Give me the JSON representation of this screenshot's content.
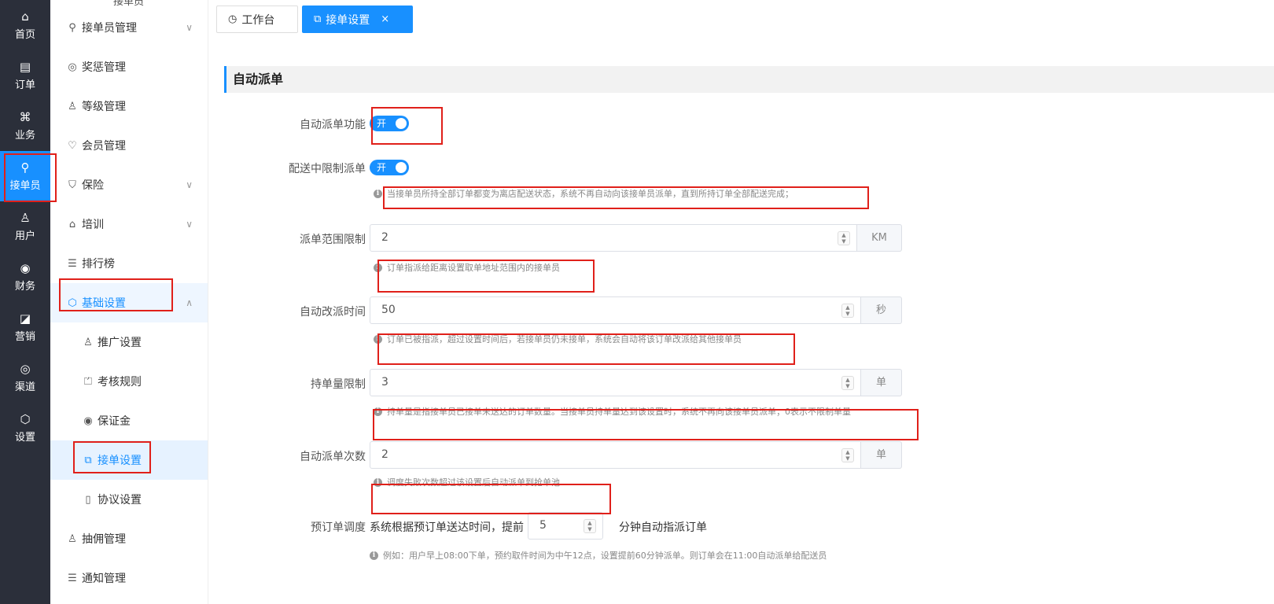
{
  "rail": {
    "items": [
      {
        "label": "首页",
        "icon": "home-icon"
      },
      {
        "label": "订单",
        "icon": "order-icon"
      },
      {
        "label": "业务",
        "icon": "business-icon"
      },
      {
        "label": "接单员",
        "icon": "rider-icon"
      },
      {
        "label": "用户",
        "icon": "user-icon"
      },
      {
        "label": "财务",
        "icon": "finance-icon"
      },
      {
        "label": "营销",
        "icon": "marketing-icon"
      },
      {
        "label": "渠道",
        "icon": "channel-icon"
      },
      {
        "label": "设置",
        "icon": "settings-icon"
      }
    ]
  },
  "sidebar": {
    "top_label": "接单员",
    "items": [
      {
        "label": "接单员管理"
      },
      {
        "label": "奖惩管理"
      },
      {
        "label": "等级管理"
      },
      {
        "label": "会员管理"
      },
      {
        "label": "保险"
      },
      {
        "label": "培训"
      },
      {
        "label": "排行榜"
      },
      {
        "label": "基础设置"
      },
      {
        "label": "推广设置"
      },
      {
        "label": "考核规则"
      },
      {
        "label": "保证金"
      },
      {
        "label": "接单设置"
      },
      {
        "label": "协议设置"
      },
      {
        "label": "抽佣管理"
      },
      {
        "label": "通知管理"
      }
    ]
  },
  "tabs": {
    "home": "工作台",
    "active": "接单设置",
    "close": "×"
  },
  "main": {
    "section_title": "自动派单",
    "fields": {
      "auto_dispatch": {
        "label": "自动派单功能",
        "switch": "开"
      },
      "limit_in_delivery": {
        "label": "配送中限制派单",
        "switch": "开",
        "hint": "当接单员所持全部订单都变为离店配送状态，系统不再自动向该接单员派单，直到所持订单全部配送完成；"
      },
      "range_limit": {
        "label": "派单范围限制",
        "value": "2",
        "unit": "KM",
        "hint": "订单指派给距离设置取单地址范围内的接单员"
      },
      "reassign_time": {
        "label": "自动改派时间",
        "value": "50",
        "unit": "秒",
        "hint": "订单已被指派，超过设置时间后，若接单员仍未接单，系统会自动将该订单改派给其他接单员"
      },
      "holding_limit": {
        "label": "持单量限制",
        "value": "3",
        "unit": "单",
        "hint": "持单量是指接单员已接单未送达的订单数量。当接单员持单量达到该设置时，系统不再向该接单员派单；0表示不限制单量"
      },
      "dispatch_times": {
        "label": "自动派单次数",
        "value": "2",
        "unit": "单",
        "hint": "调度失败次数超过该设置后自动派单到抢单池"
      },
      "preorder": {
        "label": "预订单调度",
        "prefix": "系统根据预订单送达时间，提前",
        "value": "5",
        "suffix": "分钟自动指派订单",
        "hint": "例如：用户早上08:00下单，预约取件时间为中午12点，设置提前60分钟派单。则订单会在11:00自动派单给配送员"
      }
    }
  },
  "colors": {
    "accent": "#1890ff",
    "rail_bg": "#2b2f3a",
    "highlight": "#e0201a"
  }
}
